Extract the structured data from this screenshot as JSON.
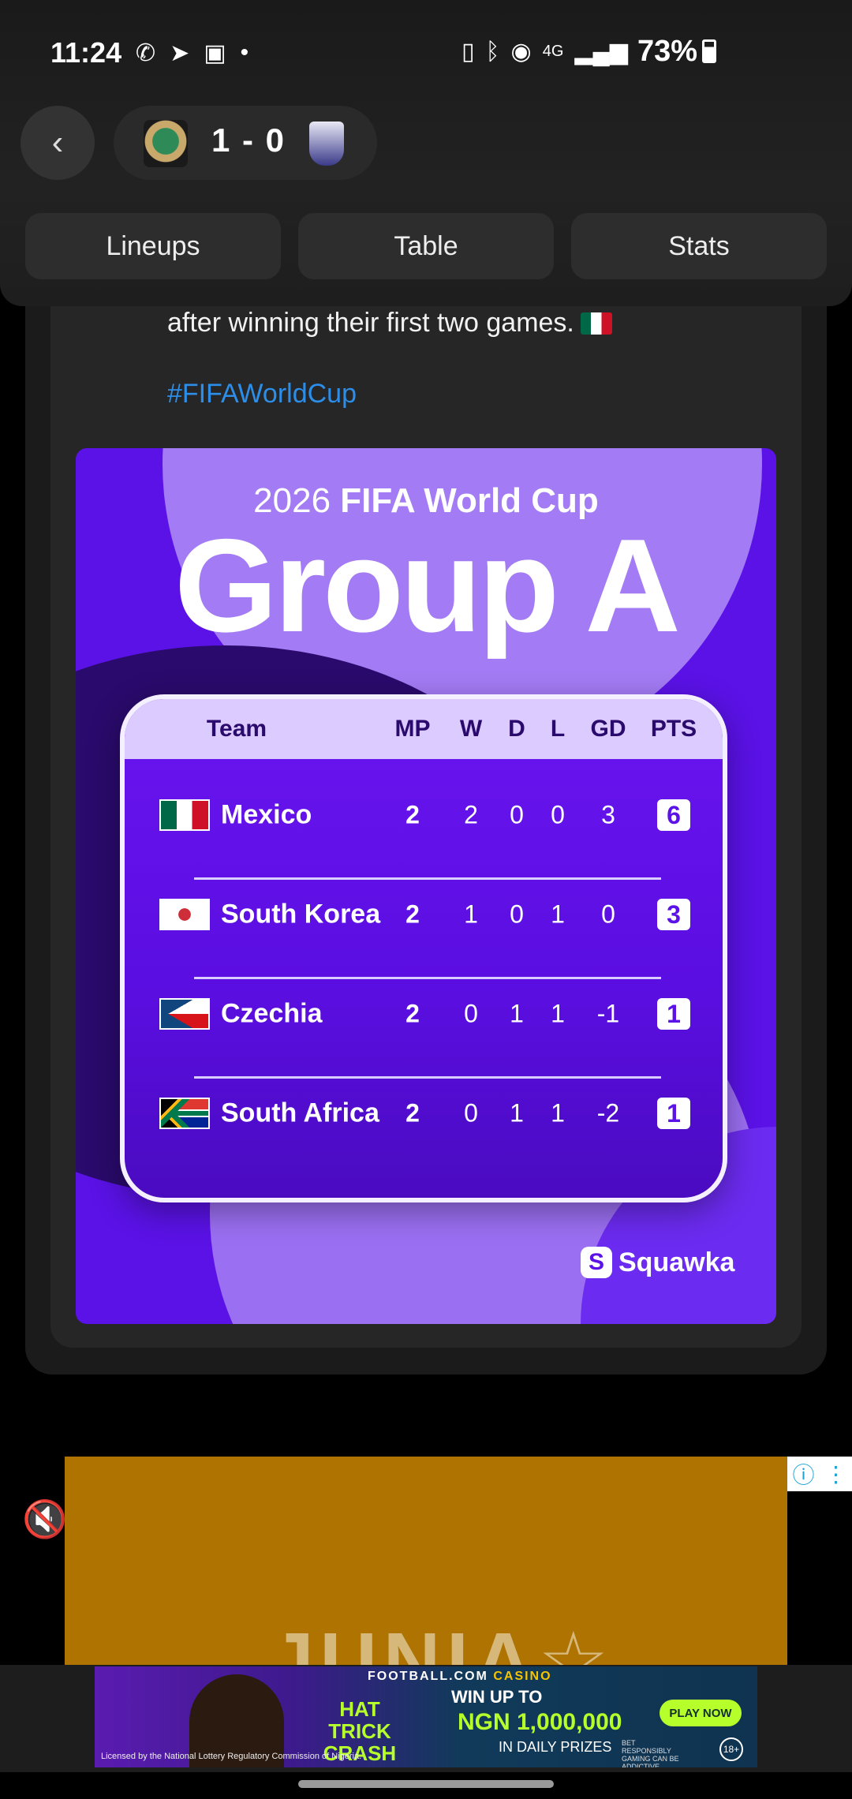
{
  "status_bar": {
    "time": "11:24",
    "left_icons": [
      "whatsapp-icon",
      "telegram-icon",
      "gallery-icon",
      "dot-icon"
    ],
    "right_icons": [
      "battery-saver-icon",
      "bluetooth-icon",
      "hotspot-icon",
      "4g-icon",
      "signal-icon"
    ],
    "battery": "73%"
  },
  "header": {
    "score": "1 - 0",
    "home_crest_text": "MEXICO"
  },
  "tabs": [
    "Lineups",
    "Table",
    "Stats"
  ],
  "post": {
    "text": "after winning their first two games.",
    "hashtag": "#FIFAWorldCup"
  },
  "graphic": {
    "subtitle_year": "2026",
    "subtitle_event": "FIFA World Cup",
    "title": "Group A",
    "brand": "Squawka",
    "headers": [
      "Team",
      "MP",
      "W",
      "D",
      "L",
      "GD",
      "PTS"
    ],
    "rows": [
      {
        "team": "Mexico",
        "mp": "2",
        "w": "2",
        "d": "0",
        "l": "0",
        "gd": "3",
        "pts": "6"
      },
      {
        "team": "South Korea",
        "mp": "2",
        "w": "1",
        "d": "0",
        "l": "1",
        "gd": "0",
        "pts": "3"
      },
      {
        "team": "Czechia",
        "mp": "2",
        "w": "0",
        "d": "1",
        "l": "1",
        "gd": "-1",
        "pts": "1"
      },
      {
        "team": "South Africa",
        "mp": "2",
        "w": "0",
        "d": "1",
        "l": "1",
        "gd": "-2",
        "pts": "1"
      }
    ]
  },
  "ad": {
    "brand_a": "FOOTBALL.COM",
    "brand_b": "CASINO",
    "game": "HAT TRICK CRASH",
    "win": "WIN UP TO",
    "amount": "NGN 1,000,000",
    "prizes": "IN DAILY PRIZES",
    "cta": "PLAY NOW",
    "responsible": "BET RESPONSIBLY GAMING CAN BE ADDICTIVE",
    "age": "18+",
    "license": "Licensed by the National Lottery Regulatory Commission of Nigeria."
  }
}
